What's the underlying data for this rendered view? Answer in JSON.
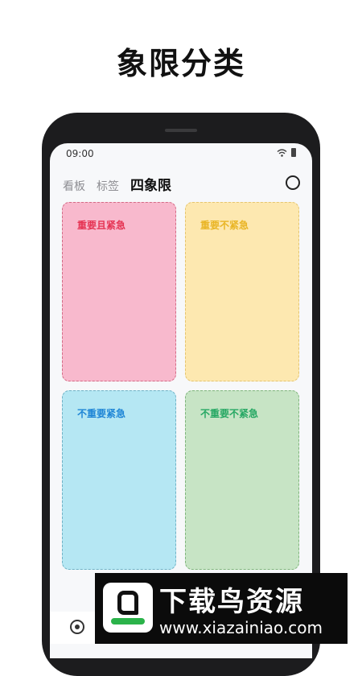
{
  "headline": "象限分类",
  "status_bar": {
    "time": "09:00"
  },
  "tabs": [
    {
      "label": "看板",
      "active": false
    },
    {
      "label": "标签",
      "active": false
    },
    {
      "label": "四象限",
      "active": true
    }
  ],
  "quadrants": [
    {
      "label": "重要且紧急",
      "bg": "#f8b9cd",
      "label_color": "#e53353"
    },
    {
      "label": "重要不紧急",
      "bg": "#fde8b0",
      "label_color": "#e9b525"
    },
    {
      "label": "不重要紧急",
      "bg": "#b5e7f3",
      "label_color": "#1f86d6"
    },
    {
      "label": "不重要不紧急",
      "bg": "#c7e4c5",
      "label_color": "#27a864"
    }
  ],
  "watermark": {
    "title": "下载鸟资源",
    "url": "www.xiazainiao.com"
  },
  "icons": [
    "wifi-icon",
    "battery-icon",
    "circle-icon",
    "target-icon"
  ]
}
